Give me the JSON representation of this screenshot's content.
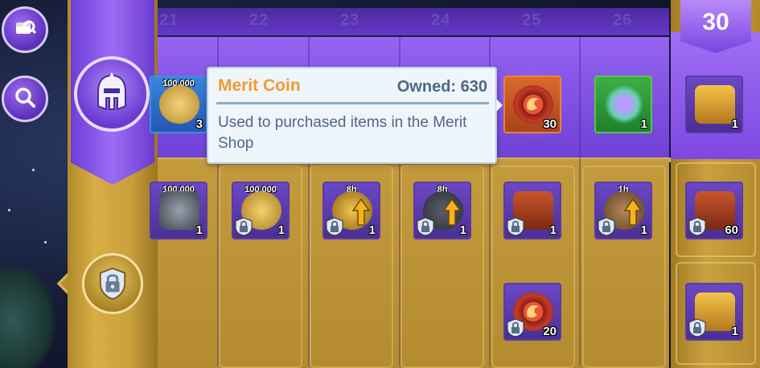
{
  "days": [
    "21",
    "22",
    "23",
    "24",
    "25",
    "26"
  ],
  "current_day": "30",
  "sidebar": {
    "buttons": [
      {
        "icon": "chest-search-icon"
      },
      {
        "icon": "search-icon"
      }
    ]
  },
  "pillar": {
    "top_icon": "spartan-helmet-icon",
    "bottom_icon": "lock-shield-icon"
  },
  "tooltip": {
    "title": "Merit Coin",
    "owned": "Owned: 630",
    "description": "Used to purchased items in the Merit Shop"
  },
  "free_rewards": [
    {
      "day": "21",
      "label": "100,000",
      "qty": "3",
      "icon": "gold-pinecone-icon",
      "frame": "blue"
    },
    {
      "day": "25",
      "label": "",
      "qty": "30",
      "icon": "merit-coin-icon",
      "frame": "orange"
    },
    {
      "day": "26",
      "label": "",
      "qty": "1",
      "icon": "crystal-plant-icon",
      "frame": "green"
    },
    {
      "day": "30",
      "label": "",
      "qty": "1",
      "icon": "golden-chest-icon",
      "frame": "purple"
    }
  ],
  "locked_rewards": [
    {
      "day": "21",
      "label": "100,000",
      "qty": "1",
      "icon": "iron-ore-icon"
    },
    {
      "day": "22",
      "label": "100,000",
      "qty": "1",
      "icon": "gold-coins-icon"
    },
    {
      "day": "23",
      "label": "8h",
      "qty": "1",
      "icon": "speedup-gold-icon"
    },
    {
      "day": "24",
      "label": "8h",
      "qty": "1",
      "icon": "speedup-anvil-icon"
    },
    {
      "day": "25",
      "label": "",
      "qty": "1",
      "icon": "red-chest-icon"
    },
    {
      "day": "26",
      "label": "1h",
      "qty": "1",
      "icon": "speedup-boots-icon"
    },
    {
      "day": "30",
      "label": "",
      "qty": "60",
      "icon": "red-chest-icon"
    }
  ],
  "locked_rewards_row2": [
    {
      "day": "25",
      "label": "",
      "qty": "20",
      "icon": "merit-coin-icon"
    },
    {
      "day": "30",
      "label": "",
      "qty": "1",
      "icon": "golden-chest-icon"
    }
  ]
}
